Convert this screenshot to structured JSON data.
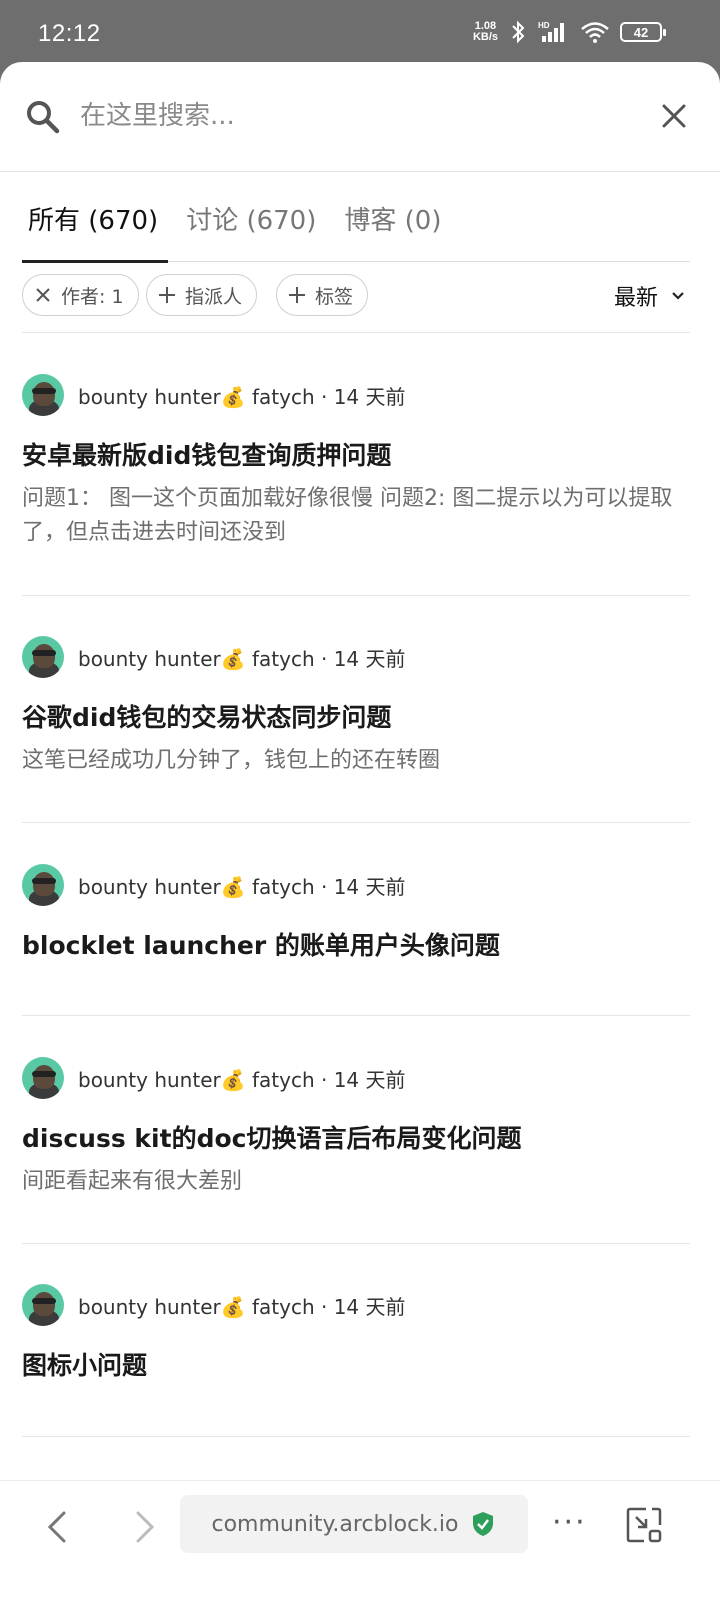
{
  "status_bar": {
    "time": "12:12",
    "net_speed_value": "1.08",
    "net_speed_unit": "KB/s",
    "battery": "42"
  },
  "search": {
    "placeholder": "在这里搜索..."
  },
  "tabs": [
    {
      "label": "所有 (670)",
      "active": true
    },
    {
      "label": "讨论 (670)",
      "active": false
    },
    {
      "label": "博客 (0)",
      "active": false
    }
  ],
  "filters": {
    "author_chip": "作者: 1",
    "assignee_chip": "指派人",
    "tag_chip": "标签",
    "sort_label": "最新"
  },
  "posts": [
    {
      "author": "bounty hunter💰 fatych · 14 天前",
      "title": "安卓最新版did钱包查询质押问题",
      "excerpt": "问题1： 图一这个页面加载好像很慢 问题2: 图二提示以为可以提取了，但点击进去时间还没到"
    },
    {
      "author": "bounty hunter💰 fatych · 14 天前",
      "title": "谷歌did钱包的交易状态同步问题",
      "excerpt": "这笔已经成功几分钟了，钱包上的还在转圈"
    },
    {
      "author": "bounty hunter💰 fatych · 14 天前",
      "title": "blocklet launcher 的账单用户头像问题",
      "excerpt": ""
    },
    {
      "author": "bounty hunter💰 fatych · 14 天前",
      "title": "discuss kit的doc切换语言后布局变化问题",
      "excerpt": "间距看起来有很大差别"
    },
    {
      "author": "bounty hunter💰 fatych · 14 天前",
      "title": "图标小问题",
      "excerpt": ""
    }
  ],
  "browser": {
    "url": "community.arcblock.io",
    "more_label": "···"
  },
  "colors": {
    "secure_badge": "#2e9e5b",
    "avatar_bg": "#59c9a5"
  }
}
